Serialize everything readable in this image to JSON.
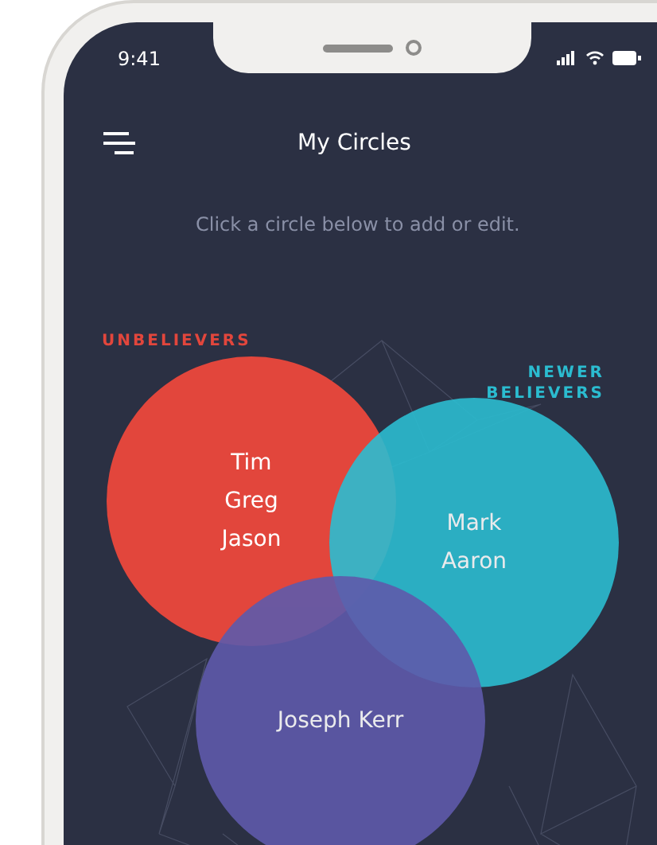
{
  "status_bar": {
    "time": "9:41"
  },
  "header": {
    "title": "My Circles"
  },
  "instruction": "Click a circle below to add or edit.",
  "circles": [
    {
      "label": "UNBELIEVERS",
      "color": "#e2463c",
      "members": [
        "Tim",
        "Greg",
        "Jason"
      ]
    },
    {
      "label": "NEWER BELIEVERS",
      "color": "#2bbcd0",
      "members": [
        "Mark",
        "Aaron"
      ]
    },
    {
      "color": "#5e5aab",
      "members": [
        "Joseph Kerr"
      ]
    }
  ]
}
